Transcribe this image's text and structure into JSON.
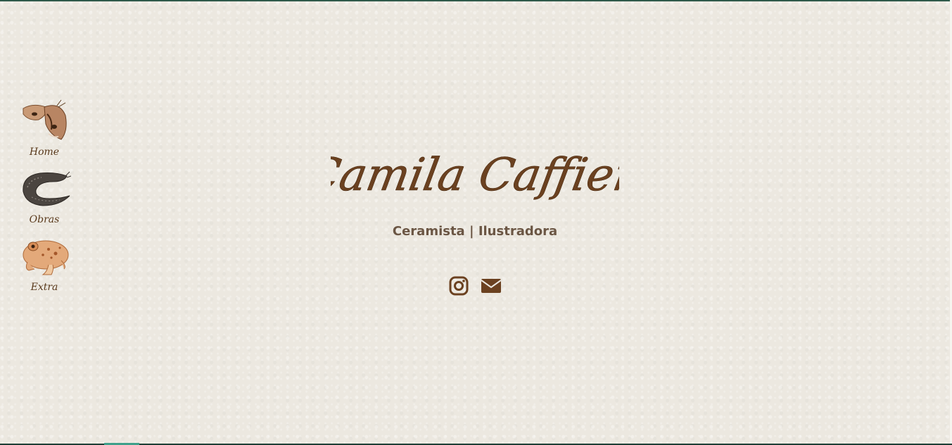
{
  "hero": {
    "name": "Camila Caffieri",
    "subtitle": "Ceramista | Ilustradora"
  },
  "nav": {
    "items": [
      {
        "label": "Home",
        "icon": "moth-illustration"
      },
      {
        "label": "Obras",
        "icon": "slug-illustration"
      },
      {
        "label": "Extra",
        "icon": "toad-illustration"
      }
    ]
  },
  "social": {
    "instagram_icon": "instagram-icon",
    "email_icon": "envelope-icon"
  },
  "colors": {
    "background": "#ece8e0",
    "accent_brown": "#6b4120",
    "subtitle_text": "#6b5644",
    "border_dark": "#1f3f36"
  }
}
